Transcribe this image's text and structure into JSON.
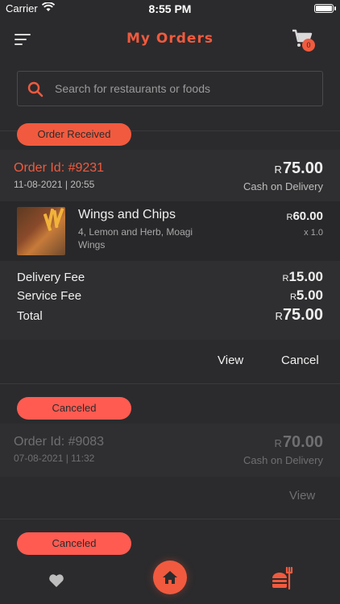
{
  "status": {
    "carrier": "Carrier",
    "time": "8:55 PM"
  },
  "header": {
    "title": "My Orders",
    "cart_count": "0"
  },
  "search": {
    "placeholder": "Search for restaurants or foods"
  },
  "orders": [
    {
      "status_label": "Order Received",
      "order_id": "Order Id: #9231",
      "date": "11-08-2021 | 20:55",
      "currency": "R",
      "amount": "75.00",
      "payment": "Cash on Delivery",
      "item": {
        "name": "Wings and Chips",
        "description": "4, Lemon and Herb, Moagi Wings",
        "currency": "R",
        "price": "60.00",
        "quantity": "x 1.0"
      },
      "fees": {
        "delivery_label": "Delivery Fee",
        "delivery_value": "15.00",
        "service_label": "Service Fee",
        "service_value": "5.00",
        "total_label": "Total",
        "total_value": "75.00"
      },
      "actions": {
        "view": "View",
        "cancel": "Cancel"
      }
    },
    {
      "status_label": "Canceled",
      "order_id": "Order Id: #9083",
      "date": "07-08-2021 | 11:32",
      "currency": "R",
      "amount": "70.00",
      "payment": "Cash on Delivery",
      "actions": {
        "view": "View"
      }
    },
    {
      "status_label": "Canceled"
    }
  ],
  "tabbar": {
    "icons": [
      "heart-icon",
      "home-icon",
      "food-icon"
    ]
  },
  "colors": {
    "accent": "#f15a3e",
    "background": "#2b2b2d",
    "canceled_pill": "#ff5b51",
    "muted_text": "#6f6f72"
  }
}
